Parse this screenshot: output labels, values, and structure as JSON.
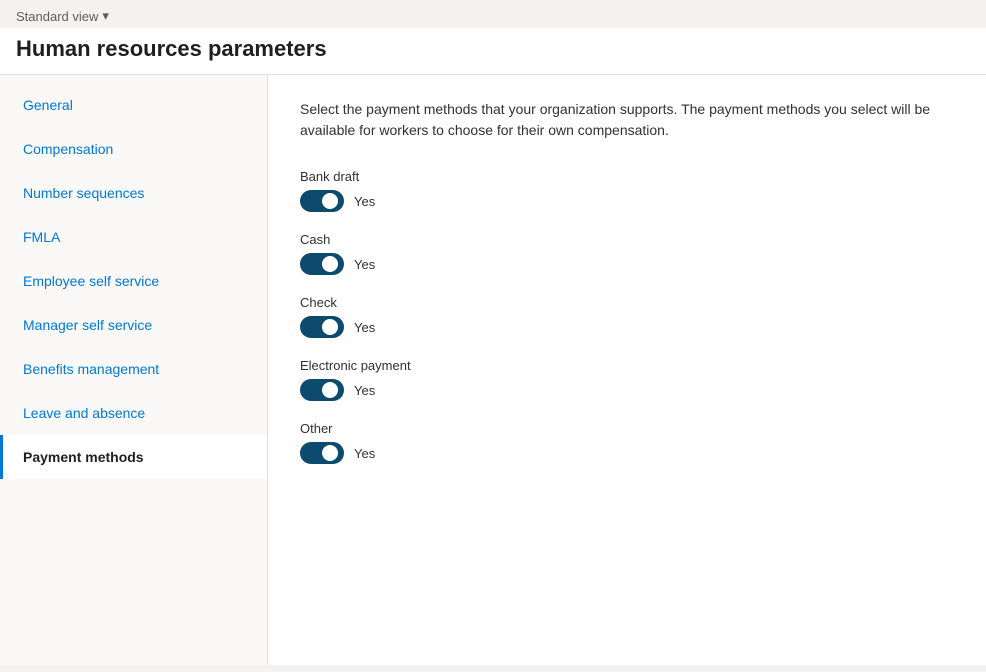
{
  "topbar": {
    "view_label": "Standard view",
    "chevron": "▾"
  },
  "header": {
    "title": "Human resources parameters"
  },
  "sidebar": {
    "items": [
      {
        "id": "general",
        "label": "General",
        "active": false
      },
      {
        "id": "compensation",
        "label": "Compensation",
        "active": false
      },
      {
        "id": "number-sequences",
        "label": "Number sequences",
        "active": false
      },
      {
        "id": "fmla",
        "label": "FMLA",
        "active": false
      },
      {
        "id": "employee-self-service",
        "label": "Employee self service",
        "active": false
      },
      {
        "id": "manager-self-service",
        "label": "Manager self service",
        "active": false
      },
      {
        "id": "benefits-management",
        "label": "Benefits management",
        "active": false
      },
      {
        "id": "leave-and-absence",
        "label": "Leave and absence",
        "active": false
      },
      {
        "id": "payment-methods",
        "label": "Payment methods",
        "active": true
      }
    ]
  },
  "main": {
    "description": "Select the payment methods that your organization supports. The payment methods you select will be available for workers to choose for their own compensation.",
    "payment_methods": [
      {
        "label": "Bank draft",
        "value": "Yes",
        "enabled": true
      },
      {
        "label": "Cash",
        "value": "Yes",
        "enabled": true
      },
      {
        "label": "Check",
        "value": "Yes",
        "enabled": true
      },
      {
        "label": "Electronic payment",
        "value": "Yes",
        "enabled": true
      },
      {
        "label": "Other",
        "value": "Yes",
        "enabled": true
      }
    ]
  }
}
